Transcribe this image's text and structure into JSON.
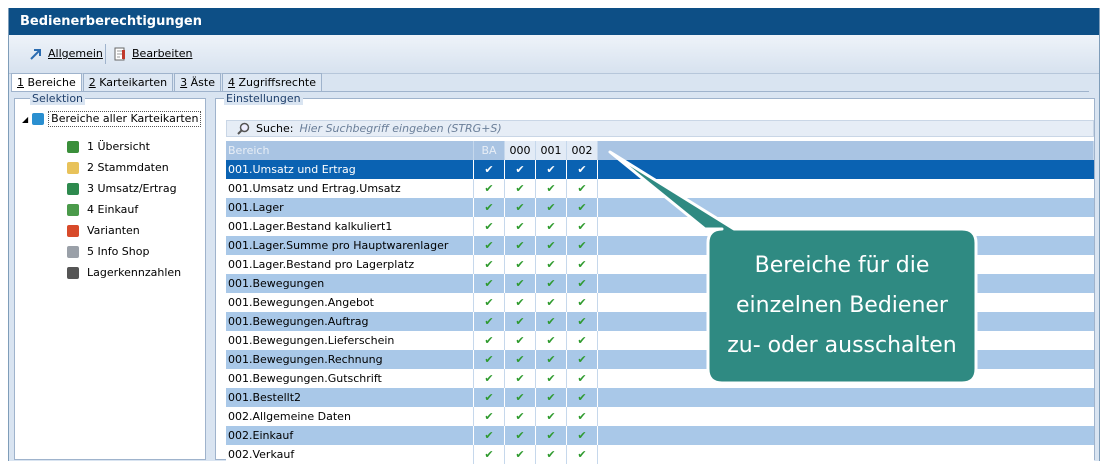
{
  "window": {
    "title": "Bedienerberechtigungen"
  },
  "toolbar": {
    "allgemein_label": "Allgemein",
    "bearbeiten_label": "Bearbeiten"
  },
  "tabs": [
    {
      "num": "1",
      "label": "Bereiche"
    },
    {
      "num": "2",
      "label": "Karteikarten"
    },
    {
      "num": "3",
      "label": "Äste"
    },
    {
      "num": "4",
      "label": "Zugriffsrechte"
    }
  ],
  "selektion": {
    "label": "Selektion",
    "root": "Bereiche aller Karteikarten",
    "items": [
      {
        "label": "1 Übersicht",
        "icon": "globe-icon",
        "color": "#3a8f3a"
      },
      {
        "label": "2 Stammdaten",
        "icon": "folder-icon",
        "color": "#e8c25a"
      },
      {
        "label": "3 Umsatz/Ertrag",
        "icon": "chart-icon",
        "color": "#2e8a4e"
      },
      {
        "label": "4 Einkauf",
        "icon": "list-icon",
        "color": "#4a9a4a"
      },
      {
        "label": "Varianten",
        "icon": "brush-icon",
        "color": "#d84a2a"
      },
      {
        "label": "5 Info Shop",
        "icon": "cart-icon",
        "color": "#9aa0a8"
      },
      {
        "label": "Lagerkennzahlen",
        "icon": "tool-icon",
        "color": "#555555"
      }
    ]
  },
  "einstellungen": {
    "label": "Einstellungen",
    "search_label": "Suche:",
    "search_placeholder": "Hier Suchbegriff eingeben (STRG+S)",
    "columns": [
      "Bereich",
      "BA",
      "000",
      "001",
      "002"
    ],
    "check": "✔",
    "rows": [
      "001.Umsatz und Ertrag",
      "001.Umsatz und Ertrag.Umsatz",
      "001.Lager",
      "001.Lager.Bestand kalkuliert1",
      "001.Lager.Summe pro Hauptwarenlager",
      "001.Lager.Bestand pro Lagerplatz",
      "001.Bewegungen",
      "001.Bewegungen.Angebot",
      "001.Bewegungen.Auftrag",
      "001.Bewegungen.Lieferschein",
      "001.Bewegungen.Rechnung",
      "001.Bewegungen.Gutschrift",
      "001.Bestellt2",
      "002.Allgemeine Daten",
      "002.Einkauf",
      "002.Verkauf"
    ],
    "selected_row": 0
  },
  "callout": {
    "lines": [
      "Bereiche für die",
      "einzelnen Bediener",
      "zu- oder ausschalten"
    ],
    "color": "#2f8a82"
  }
}
